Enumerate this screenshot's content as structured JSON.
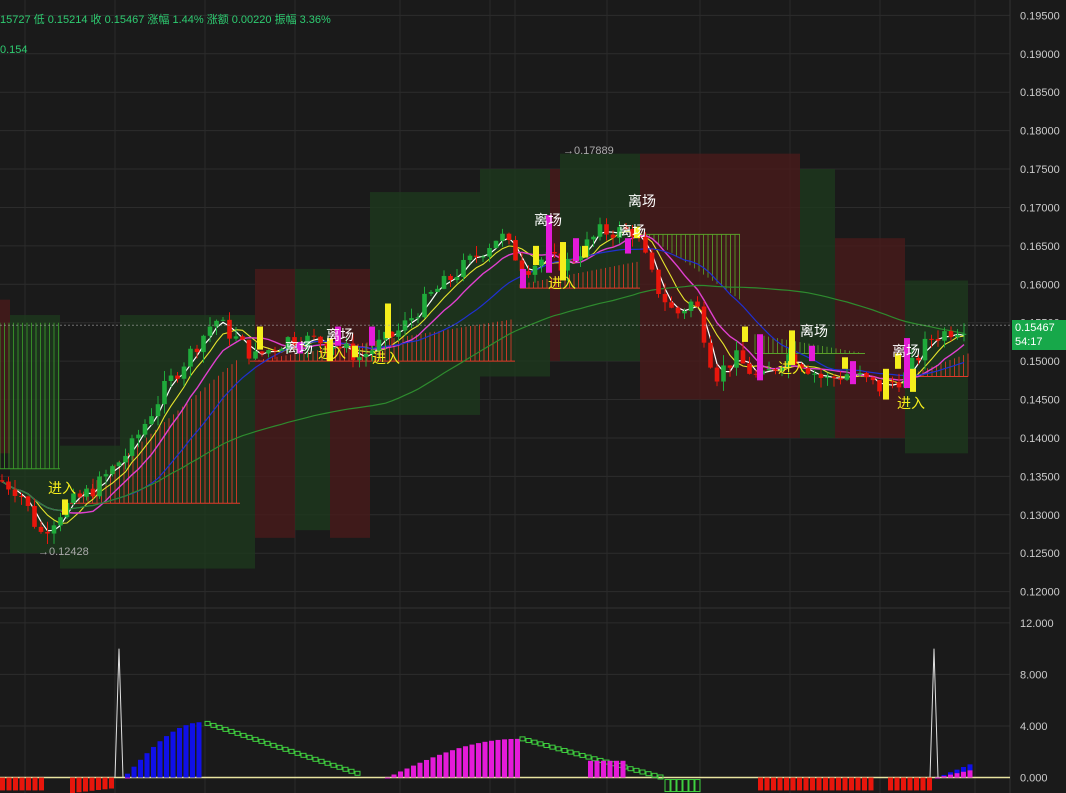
{
  "header": {
    "info_text": "15727  低 0.15214  收 0.15467  涨幅 1.44%  涨额 0.00220  振幅 3.36%",
    "indicator_text": "0.154"
  },
  "price_tag": {
    "price": "0.15467",
    "countdown": "54:17"
  },
  "annotations": {
    "high": "→0.17889",
    "low": "→0.12428",
    "exit_label": "离场",
    "enter_label": "进入"
  },
  "colors": {
    "background": "#1a1a1a",
    "up": "#1faa3b",
    "down": "#e8160c",
    "signal_yellow": "#f5ee1c",
    "signal_magenta": "#e41bd8",
    "macd_blue": "#1010e8",
    "ma_white": "#ffffff",
    "ma_yellow": "#e6e62e",
    "ma_magenta": "#e040d0",
    "ma_blue": "#2030d0",
    "ma_green": "#2e8b2e"
  },
  "chart_data": [
    {
      "type": "candlestick",
      "ylim": [
        0.118,
        0.197
      ],
      "y_ticks": [
        "0.19500",
        "0.19000",
        "0.18500",
        "0.18000",
        "0.17500",
        "0.17000",
        "0.16500",
        "0.16000",
        "0.15500",
        "0.15000",
        "0.14500",
        "0.14000",
        "0.13500",
        "0.13000",
        "0.12500",
        "0.12000"
      ],
      "last_close": 0.15467,
      "marked_high": 0.17889,
      "marked_low": 0.12428,
      "exit_signals": 7,
      "enter_signals": 6
    },
    {
      "type": "bar",
      "ylim": [
        -1.2,
        13
      ],
      "y_ticks": [
        "12.000",
        "8.000",
        "4.000",
        "0.000"
      ],
      "peak_lines": [
        10.0,
        10.0
      ]
    }
  ]
}
